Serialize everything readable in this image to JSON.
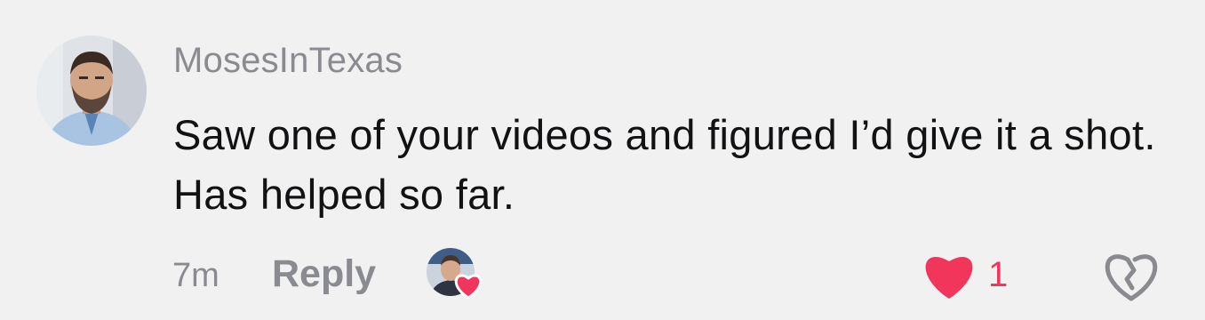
{
  "comment": {
    "username": "MosesInTexas",
    "text": "Saw one of your videos and figured I’d give it a shot. Has helped so far.",
    "timestamp": "7m",
    "reply_label": "Reply",
    "like_count": "1",
    "liked_by_creator": true
  },
  "icons": {
    "like": "heart-icon",
    "dislike": "broken-heart-icon",
    "creator_badge": "mini-heart-icon"
  },
  "colors": {
    "background": "#f1f1f2",
    "accent": "#f2355b",
    "muted_text": "#8a8b91",
    "primary_text": "#111214"
  }
}
